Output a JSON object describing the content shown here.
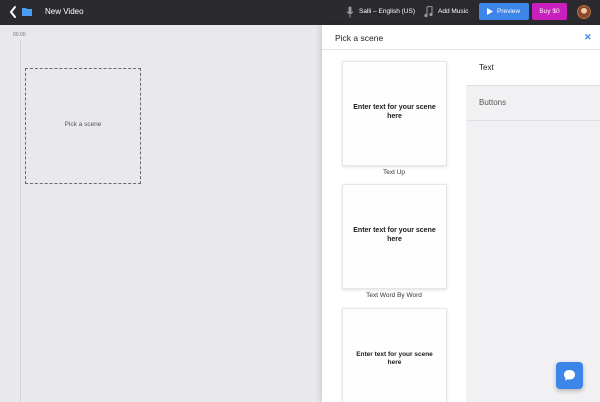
{
  "header": {
    "title": "New Video",
    "voice_label": "Salli – English (US)",
    "music_label": "Add Music",
    "preview_label": "Preview",
    "buy_label": "Buy $0"
  },
  "timeline": {
    "time": "00:00",
    "placeholder": "Pick a scene"
  },
  "panel": {
    "title": "Pick a scene",
    "scenes": [
      {
        "text": "Enter text for your scene here",
        "label": "Text Up"
      },
      {
        "text": "Enter text for your scene here",
        "label": "Text Word By Word"
      },
      {
        "text": "Enter text for your scene here",
        "label": ""
      }
    ],
    "categories": [
      {
        "label": "Text",
        "active": true
      },
      {
        "label": "Buttons",
        "active": false
      }
    ]
  },
  "colors": {
    "topbar": "#2b2a2f",
    "accent_blue": "#3d85e8",
    "buy_magenta": "#c81fbd"
  },
  "icons": [
    "back-arrow-icon",
    "folder-icon",
    "microphone-icon",
    "music-note-icon",
    "play-icon",
    "avatar",
    "close-icon",
    "chat-icon"
  ]
}
